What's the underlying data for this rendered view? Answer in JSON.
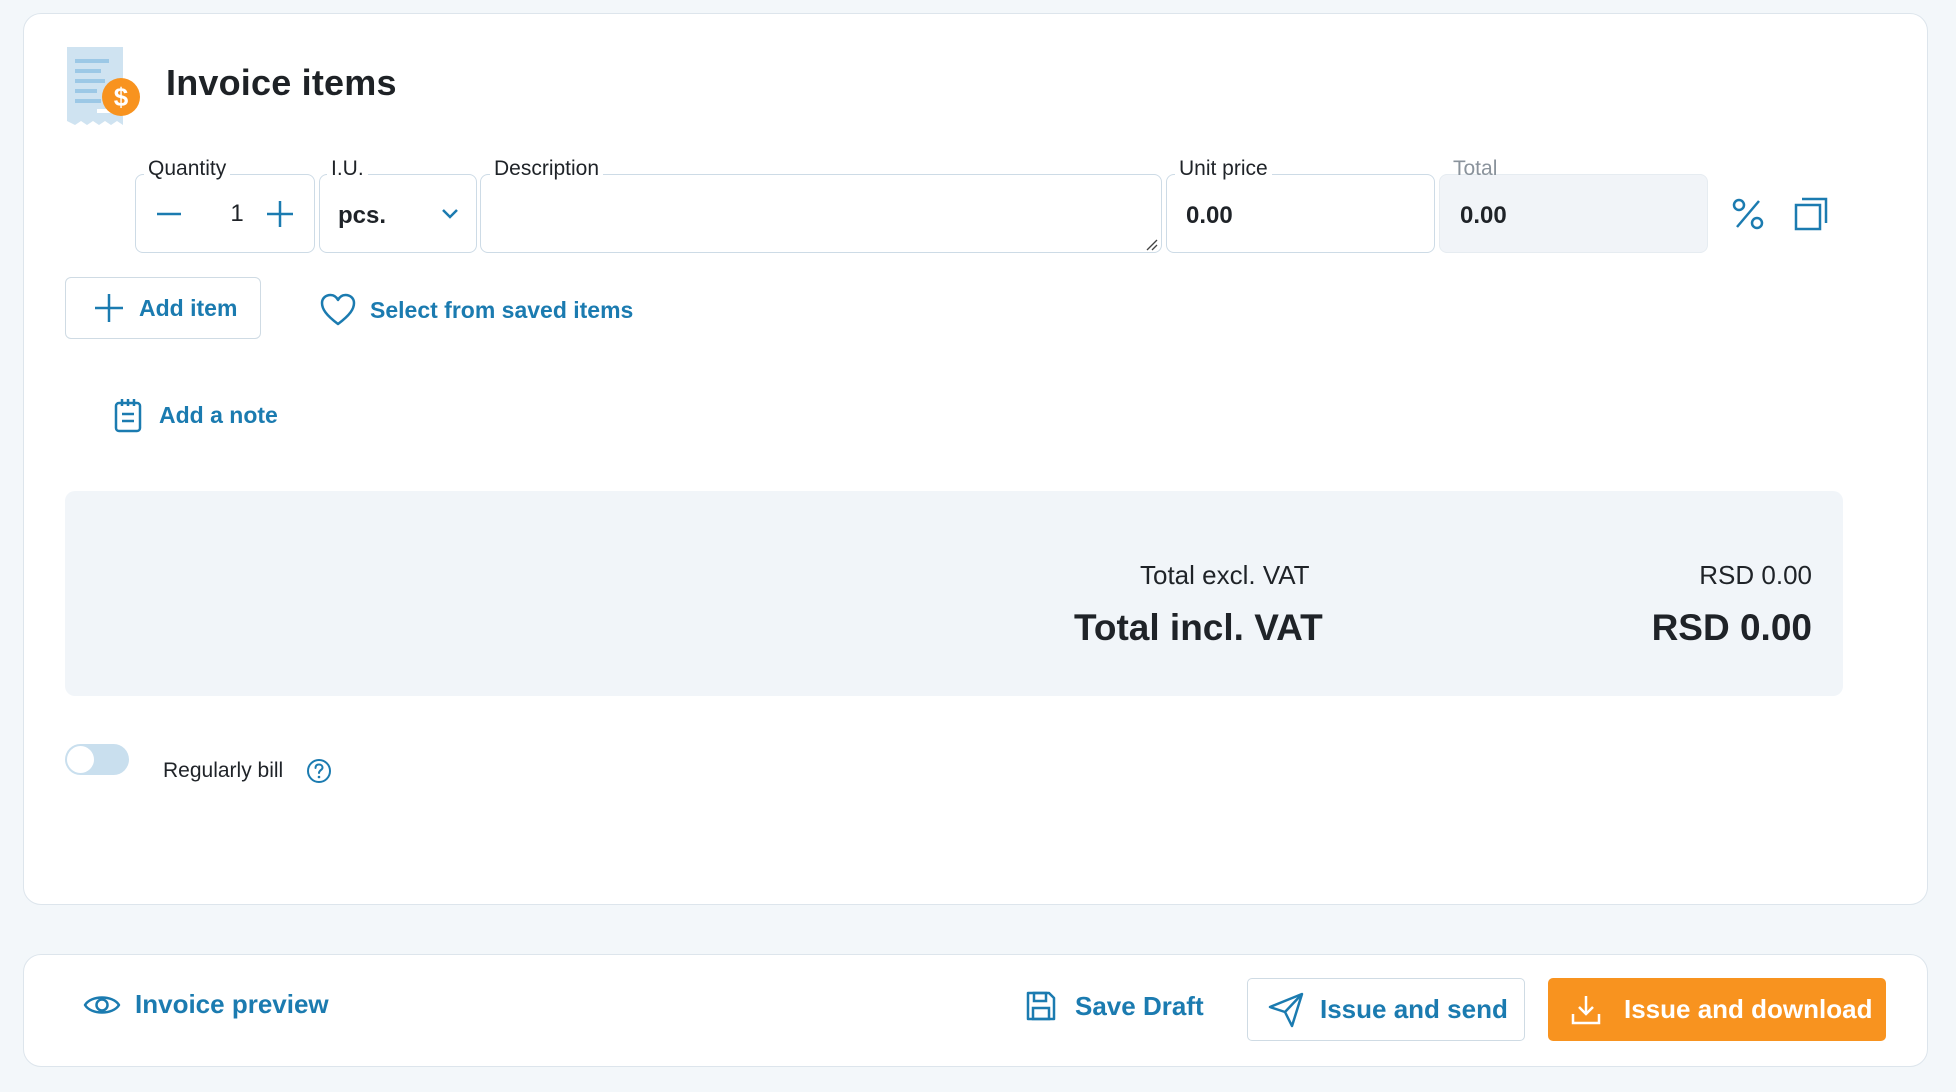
{
  "section": {
    "title": "Invoice items"
  },
  "item": {
    "quantity_label": "Quantity",
    "quantity_value": "1",
    "unit_label": "I.U.",
    "unit_value": "pcs.",
    "description_label": "Description",
    "description_value": "",
    "unit_price_label": "Unit price",
    "unit_price_value": "0.00",
    "total_label": "Total",
    "total_value": "0.00"
  },
  "actions": {
    "add_item": "Add item",
    "select_saved": "Select from saved items",
    "add_note": "Add a note"
  },
  "totals": {
    "excl_label": "Total excl. VAT",
    "excl_value": "RSD 0.00",
    "incl_label": "Total incl. VAT",
    "incl_value": "RSD 0.00"
  },
  "recurring": {
    "label": "Regularly bill",
    "enabled": false
  },
  "footer": {
    "preview": "Invoice preview",
    "save_draft": "Save Draft",
    "issue_send": "Issue and send",
    "issue_download": "Issue and download"
  },
  "icons": {
    "header": "invoice-dollar-icon",
    "discount": "percent-icon",
    "duplicate": "copy-icon",
    "add": "plus-icon",
    "saved": "heart-icon",
    "note": "notepad-icon",
    "help": "question-circle-icon",
    "preview": "eye-icon",
    "save": "floppy-icon",
    "send": "paper-plane-icon",
    "download": "download-icon"
  },
  "colors": {
    "accent": "#1b7bb0",
    "primary_button": "#f8931f",
    "page_background": "#f3f7fa",
    "totals_background": "#f1f5f9"
  }
}
